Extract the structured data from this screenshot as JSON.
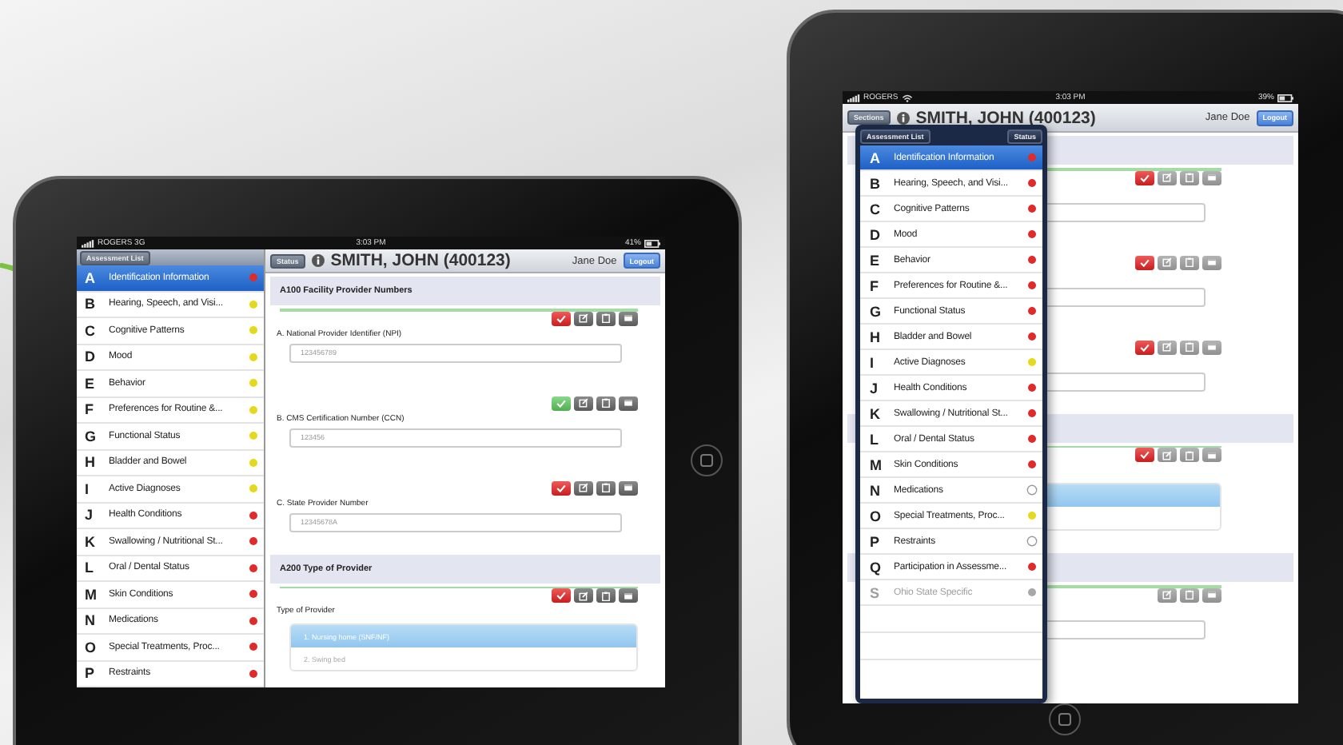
{
  "left_tablet": {
    "status_bar": {
      "carrier": "ROGERS 3G",
      "wifi": false,
      "time": "3:03 PM",
      "battery": "41%"
    },
    "sidebar": {
      "button": "Assessment List",
      "items": [
        {
          "letter": "A",
          "label": "Identification Information",
          "color": "#e02b2b",
          "selected": true,
          "disabled": false
        },
        {
          "letter": "B",
          "label": "Hearing, Speech, and Visi...",
          "color": "#e6d81c",
          "selected": false,
          "disabled": false
        },
        {
          "letter": "C",
          "label": "Cognitive Patterns",
          "color": "#e6d81c",
          "selected": false,
          "disabled": false
        },
        {
          "letter": "D",
          "label": "Mood",
          "color": "#e6d81c",
          "selected": false,
          "disabled": false
        },
        {
          "letter": "E",
          "label": "Behavior",
          "color": "#e6d81c",
          "selected": false,
          "disabled": false
        },
        {
          "letter": "F",
          "label": "Preferences for Routine &...",
          "color": "#e6d81c",
          "selected": false,
          "disabled": false
        },
        {
          "letter": "G",
          "label": "Functional Status",
          "color": "#e6d81c",
          "selected": false,
          "disabled": false
        },
        {
          "letter": "H",
          "label": "Bladder and Bowel",
          "color": "#e6d81c",
          "selected": false,
          "disabled": false
        },
        {
          "letter": "I",
          "label": "Active Diagnoses",
          "color": "#e6d81c",
          "selected": false,
          "disabled": false
        },
        {
          "letter": "J",
          "label": "Health Conditions",
          "color": "#e02b2b",
          "selected": false,
          "disabled": false
        },
        {
          "letter": "K",
          "label": "Swallowing / Nutritional St...",
          "color": "#e02b2b",
          "selected": false,
          "disabled": false
        },
        {
          "letter": "L",
          "label": "Oral / Dental Status",
          "color": "#e02b2b",
          "selected": false,
          "disabled": false
        },
        {
          "letter": "M",
          "label": "Skin Conditions",
          "color": "#e02b2b",
          "selected": false,
          "disabled": false
        },
        {
          "letter": "N",
          "label": "Medications",
          "color": "#e02b2b",
          "selected": false,
          "disabled": false
        },
        {
          "letter": "O",
          "label": "Special Treatments, Proc...",
          "color": "#e02b2b",
          "selected": false,
          "disabled": false
        },
        {
          "letter": "P",
          "label": "Restraints",
          "color": "#e02b2b",
          "selected": false,
          "disabled": false
        }
      ]
    },
    "header": {
      "left_button": "Status",
      "patient": "SMITH, JOHN (400123)",
      "user": "Jane Doe",
      "logout": "Logout"
    },
    "sections": [
      {
        "title": "A100 Facility Provider Numbers",
        "questions": [
          {
            "kind": "field",
            "label": "A. National Provider Identifier (NPI)",
            "value": "123456789",
            "check_shown": true,
            "done": false
          },
          {
            "kind": "field",
            "label": "B. CMS Certification Number (CCN)",
            "value": "123456",
            "check_shown": true,
            "done": true
          },
          {
            "kind": "field",
            "label": "C. State Provider Number",
            "value": "12345678A",
            "check_shown": true,
            "done": false
          }
        ]
      },
      {
        "title": "A200 Type of Provider",
        "questions": [
          {
            "kind": "options",
            "label": "Type of Provider",
            "check_shown": true,
            "done": false,
            "options": [
              {
                "label": "1. Nursing home (SNF/NF)",
                "selected": true
              },
              {
                "label": "2. Swing bed",
                "selected": false
              }
            ]
          }
        ]
      }
    ]
  },
  "right_tablet": {
    "status_bar": {
      "carrier": "ROGERS",
      "wifi": true,
      "time": "3:03 PM",
      "battery": "39%"
    },
    "header": {
      "left_button": "Sections",
      "patient": "SMITH, JOHN (400123)",
      "user": "Jane Doe",
      "logout": "Logout"
    },
    "sections": [
      {
        "questions": [
          {
            "kind": "field",
            "check_shown": true,
            "done": false
          },
          {
            "kind": "field",
            "check_shown": true,
            "done": false
          },
          {
            "kind": "field",
            "check_shown": true,
            "done": false
          }
        ]
      },
      {
        "questions": [
          {
            "kind": "options",
            "check_shown": true,
            "done": false,
            "options": [
              {
                "selected": true
              },
              {
                "selected": false
              }
            ]
          }
        ]
      },
      {
        "questions": [
          {
            "kind": "field",
            "check_shown": false
          }
        ]
      }
    ],
    "popover": {
      "title": "Assessment List",
      "status_button": "Status",
      "items": [
        {
          "letter": "A",
          "label": "Identification Information",
          "color": "#e02b2b",
          "selected": true,
          "disabled": false
        },
        {
          "letter": "B",
          "label": "Hearing, Speech, and Visi...",
          "color": "#e02b2b",
          "selected": false,
          "disabled": false
        },
        {
          "letter": "C",
          "label": "Cognitive Patterns",
          "color": "#e02b2b",
          "selected": false,
          "disabled": false
        },
        {
          "letter": "D",
          "label": "Mood",
          "color": "#e02b2b",
          "selected": false,
          "disabled": false
        },
        {
          "letter": "E",
          "label": "Behavior",
          "color": "#e02b2b",
          "selected": false,
          "disabled": false
        },
        {
          "letter": "F",
          "label": "Preferences for Routine &...",
          "color": "#e02b2b",
          "selected": false,
          "disabled": false
        },
        {
          "letter": "G",
          "label": "Functional Status",
          "color": "#e02b2b",
          "selected": false,
          "disabled": false
        },
        {
          "letter": "H",
          "label": "Bladder and Bowel",
          "color": "#e02b2b",
          "selected": false,
          "disabled": false
        },
        {
          "letter": "I",
          "label": "Active Diagnoses",
          "color": "#e6d81c",
          "selected": false,
          "disabled": false
        },
        {
          "letter": "J",
          "label": "Health Conditions",
          "color": "#e02b2b",
          "selected": false,
          "disabled": false
        },
        {
          "letter": "K",
          "label": "Swallowing / Nutritional St...",
          "color": "#e02b2b",
          "selected": false,
          "disabled": false
        },
        {
          "letter": "L",
          "label": "Oral / Dental Status",
          "color": "#e02b2b",
          "selected": false,
          "disabled": false
        },
        {
          "letter": "M",
          "label": "Skin Conditions",
          "color": "#e02b2b",
          "selected": false,
          "disabled": false
        },
        {
          "letter": "N",
          "label": "Medications",
          "color": "#ffffff",
          "selected": false,
          "disabled": false
        },
        {
          "letter": "O",
          "label": "Special Treatments, Proc...",
          "color": "#e6d81c",
          "selected": false,
          "disabled": false
        },
        {
          "letter": "P",
          "label": "Restraints",
          "color": "#ffffff",
          "selected": false,
          "disabled": false
        },
        {
          "letter": "Q",
          "label": "Participation in Assessme...",
          "color": "#e02b2b",
          "selected": false,
          "disabled": false
        },
        {
          "letter": "S",
          "label": "Ohio State Specific",
          "color": "#a8a8a8",
          "selected": false,
          "disabled": true
        }
      ]
    }
  }
}
